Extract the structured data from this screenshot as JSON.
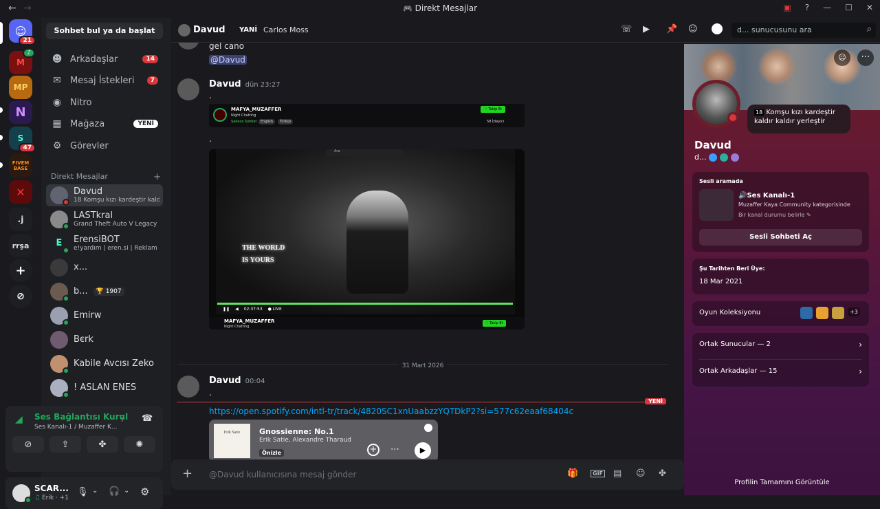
{
  "window": {
    "title": "Direkt Mesajlar",
    "back": "←",
    "forward": "→"
  },
  "servers": {
    "home_badge": "21",
    "s4_badge": "47",
    "j_label": ".j",
    "rrsa_label": "rrşa",
    "fivem_label": "FIVEM BASE"
  },
  "sidebar": {
    "search_label": "Sohbet bul ya da başlat",
    "nav": [
      {
        "label": "Arkadaşlar",
        "badge": "14",
        "icon": "friends-icon"
      },
      {
        "label": "Mesaj İstekleri",
        "badge": "7",
        "icon": "mail-icon"
      },
      {
        "label": "Nitro",
        "icon": "nitro-icon"
      },
      {
        "label": "Mağaza",
        "badge": "YENİ",
        "icon": "shop-icon"
      },
      {
        "label": "Görevler",
        "icon": "quests-icon"
      }
    ],
    "dm_header": "Direkt Mesajlar",
    "dm_add": "+",
    "dms": [
      {
        "name": "Davud",
        "sub": "18 Komşu kızı kardeştir kaldır kaldır yerleştir",
        "status": "dnd"
      },
      {
        "name": "LASTkral",
        "sub": "Grand Theft Auto V Legacy",
        "status": "online"
      },
      {
        "name": "ErensiBOT",
        "sub": "e!yardım | eren.si | Reklam yasak",
        "status": "online"
      },
      {
        "name": "x...",
        "sub": "",
        "status": ""
      },
      {
        "name": "b...",
        "tag": "1907",
        "status": "online"
      },
      {
        "name": "Emirw",
        "status": "online"
      },
      {
        "name": "Bєrk",
        "status": ""
      },
      {
        "name": "Kabile Avcısı Zeko",
        "status": "online"
      },
      {
        "name": "! ASLAN ENES",
        "status": "online"
      }
    ]
  },
  "voice": {
    "title": "Ses Bağlantısı Kurul",
    "sub": "Ses Kanalı-1 / Muzaffer K..."
  },
  "user": {
    "name": "SCAR...",
    "activity": "Erik",
    "extra": "+1"
  },
  "chat": {
    "header_name": "Davud",
    "header_new": "YANİ",
    "header_game": "Carlos Moss",
    "search_placeholder": "d... sunucusunu ara",
    "top_text": "gel cano",
    "top_mention": "@Davud",
    "msg1": {
      "author": "Davud",
      "time": "dün 23:27",
      "text1": ".",
      "text2": "."
    },
    "embed_top": {
      "name": "MAFYA_MUZAFFER",
      "sub": "Night Chatting",
      "category": "Sadece Sohbet",
      "tag1": "English",
      "tag2": "Türkçe",
      "follow": "♡ Takip Et",
      "viewers": "58 İzleyici"
    },
    "video": {
      "overlay": "THE WORLD IS YOURS",
      "time": "02:37:53",
      "live": "LIVE",
      "name": "MAFYA_MUZAFFER",
      "sub": "Night Chatting",
      "follow": "♡ Takip Et",
      "search": "Ara"
    },
    "divider_date": "31 Mart 2026",
    "msg2": {
      "author": "Davud",
      "time": "00:04",
      "text": ".",
      "link": "https://open.spotify.com/intl-tr/track/4820SC1xnUaabzzYQTDkP2?si=577c62eaaf68404c"
    },
    "new_badge": "YENİ",
    "spotify": {
      "title": "Gnossienne: No.1",
      "artist": "Erik Satie, Alexandre Tharaud",
      "preview": "Önizle",
      "album_text": "Erik Satie"
    },
    "input_placeholder": "@Davud kullanıcısına mesaj gönder"
  },
  "profile": {
    "name": "Davud",
    "tag": "d...",
    "status_text": "Komşu kızı kardeştir kaldır kaldır yerleştir",
    "status_age": "18",
    "voice_title": "Sesli aramada",
    "voice_channel": "Ses Kanalı-1",
    "voice_sub": "Muzaffer Kaya Community kategorisinde",
    "voice_status": "Bir kanal durumu belirle",
    "voice_button": "Sesli Sohbeti Aç",
    "member_title": "Şu Tarihten Beri Üye:",
    "member_date": "18 Mar 2021",
    "games_title": "Oyun Koleksiyonu",
    "games_more": "+3",
    "mutual_servers": "Ortak Sunucular — 2",
    "mutual_friends": "Ortak Arkadaşlar — 15",
    "view_full": "Profilin Tamamını Görüntüle"
  },
  "colors": {
    "accent": "#5865f2",
    "red": "#da373c",
    "green": "#23a55a",
    "profile": "#6e1d2a"
  }
}
